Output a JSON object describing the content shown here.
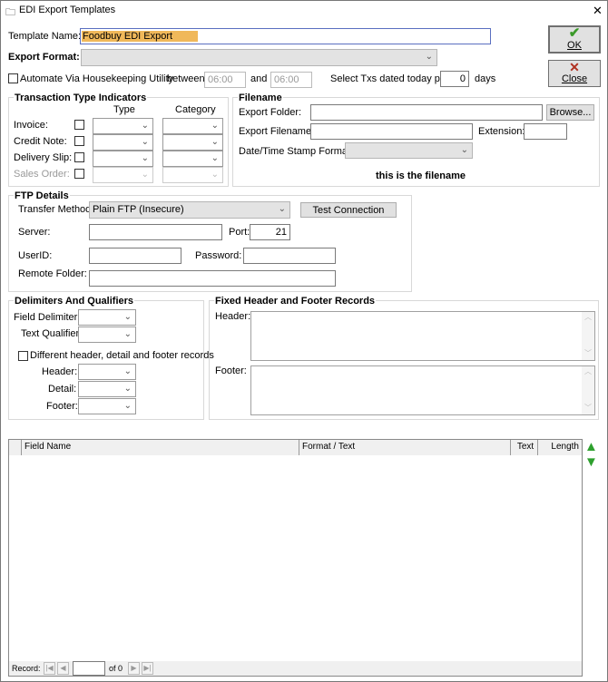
{
  "window": {
    "title": "EDI Export Templates",
    "close_glyph": "✕"
  },
  "template_name": {
    "label": "Template Name:",
    "value": "Foodbuy EDI Export"
  },
  "export_format": {
    "label": "Export Format:",
    "value": ""
  },
  "automate": {
    "label": "Automate Via Housekeeping Utility",
    "checked": false,
    "between_label": "between",
    "from_time": "06:00",
    "and_label": "and",
    "to_time": "06:00"
  },
  "select_txs": {
    "label": "Select Txs dated today plus",
    "value": "0",
    "unit": "days"
  },
  "buttons": {
    "ok": "OK",
    "close": "Close",
    "browse": "Browse...",
    "test_connection": "Test Connection"
  },
  "transaction_types": {
    "title": "Transaction Type Indicators",
    "col_type": "Type",
    "col_category": "Category",
    "rows": [
      {
        "label": "Invoice:"
      },
      {
        "label": "Credit Note:"
      },
      {
        "label": "Delivery Slip:"
      },
      {
        "label": "Sales Order:"
      }
    ]
  },
  "filename": {
    "title": "Filename",
    "folder_label": "Export Folder:",
    "folder_value": "",
    "filename_label": "Export Filename:",
    "filename_value": "",
    "extension_label": "Extension:",
    "extension_value": "",
    "stamp_label": "Date/Time Stamp Format:",
    "preview": "this is the filename"
  },
  "ftp": {
    "title": "FTP Details",
    "method_label": "Transfer Method:",
    "method_value": "Plain FTP (Insecure)",
    "server_label": "Server:",
    "port_label": "Port:",
    "port_value": "21",
    "userid_label": "UserID:",
    "password_label": "Password:",
    "remote_label": "Remote Folder:"
  },
  "delimiters": {
    "title": "Delimiters And Qualifiers",
    "field_label": "Field Delimiter:",
    "qualifier_label": "Text Qualifier:",
    "different_label": "Different header, detail and footer records",
    "header_label": "Header:",
    "detail_label": "Detail:",
    "footer_label": "Footer:"
  },
  "fixed": {
    "title": "Fixed Header and Footer Records",
    "header_label": "Header:",
    "footer_label": "Footer:"
  },
  "grid": {
    "columns": [
      "Field Name",
      "Format / Text",
      "Text",
      "Length"
    ],
    "record_label": "Record:",
    "of_label": "of 0"
  },
  "colors": {
    "highlight": "#f0b85a",
    "ok_check": "#3b9a2a",
    "close_x": "#b03020",
    "up": "#2ea02e"
  }
}
